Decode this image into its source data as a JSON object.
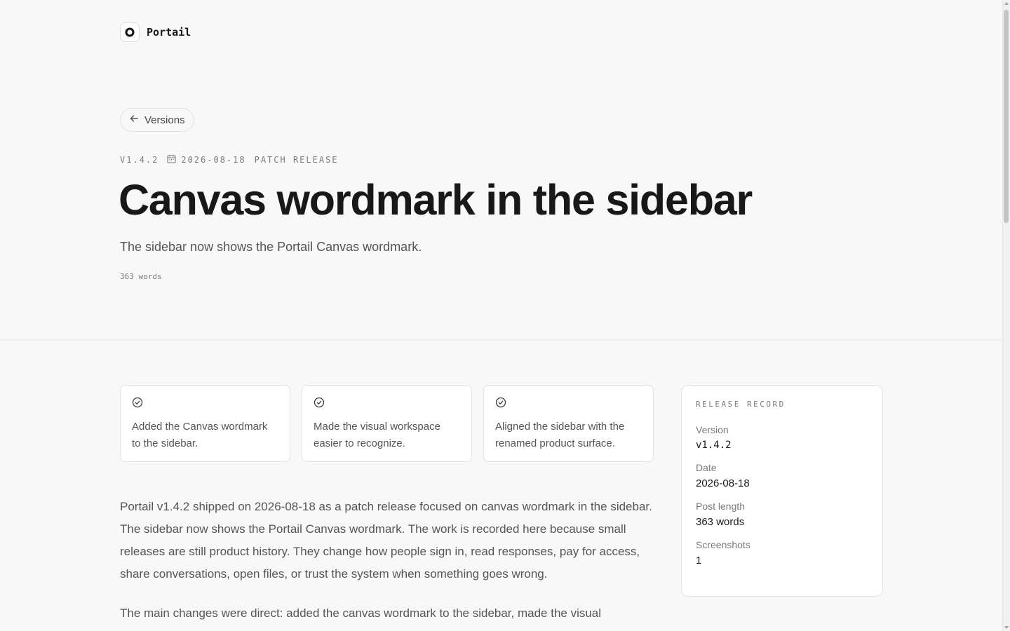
{
  "brand": {
    "name": "Portail",
    "logo_icon": "ring-logo-icon"
  },
  "nav": {
    "back_label": "Versions"
  },
  "release": {
    "version_tag": "V1.4.2",
    "date": "2026-08-18",
    "type": "PATCH RELEASE",
    "title": "Canvas wordmark in the sidebar",
    "subtitle": "The sidebar now shows the Portail Canvas wordmark.",
    "word_count": "363 words"
  },
  "highlights": [
    {
      "text": "Added the Canvas wordmark to the sidebar."
    },
    {
      "text": "Made the visual workspace easier to recognize."
    },
    {
      "text": "Aligned the sidebar with the renamed product surface."
    }
  ],
  "article": {
    "paragraphs": [
      "Portail v1.4.2 shipped on 2026-08-18 as a patch release focused on canvas wordmark in the sidebar. The sidebar now shows the Portail Canvas wordmark. The work is recorded here because small releases are still product history. They change how people sign in, read responses, pay for access, share conversations, open files, or trust the system when something goes wrong.",
      "The main changes were direct: added the canvas wordmark to the sidebar, made the visual"
    ]
  },
  "record": {
    "heading": "RELEASE RECORD",
    "items": [
      {
        "label": "Version",
        "value": "v1.4.2"
      },
      {
        "label": "Date",
        "value": "2026-08-18"
      },
      {
        "label": "Post length",
        "value": "363 words"
      },
      {
        "label": "Screenshots",
        "value": "1"
      }
    ]
  }
}
